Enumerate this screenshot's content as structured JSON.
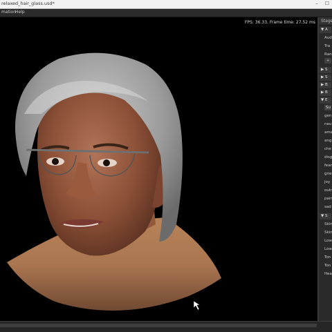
{
  "window": {
    "title": "relaxed_hair_glass.usd*"
  },
  "menu": {
    "items": [
      "mation",
      "Help"
    ]
  },
  "viewport": {
    "stats": "FPS: 36.33, Frame time: 27.52 ms"
  },
  "panel": {
    "title": "Stage",
    "row_audio": "Audi",
    "row_track": "Tra",
    "row_range": "Ran",
    "row_button": "+",
    "sec_a": "A",
    "sec_1": "S",
    "sec_2": "S",
    "sec_3": "B",
    "sec_4": "B",
    "sec_e": "E",
    "field_search": "Su",
    "emotions": [
      "gen",
      "neu",
      "ama",
      "ang",
      "che",
      "disg",
      "fear",
      "grie",
      "joy",
      "outr",
      "pain",
      "sad"
    ],
    "sec_bottom": "S",
    "bottom_rows": [
      "Skin",
      "Skin",
      "Low",
      "Low",
      "Ton",
      "Ton",
      "Hea"
    ]
  }
}
